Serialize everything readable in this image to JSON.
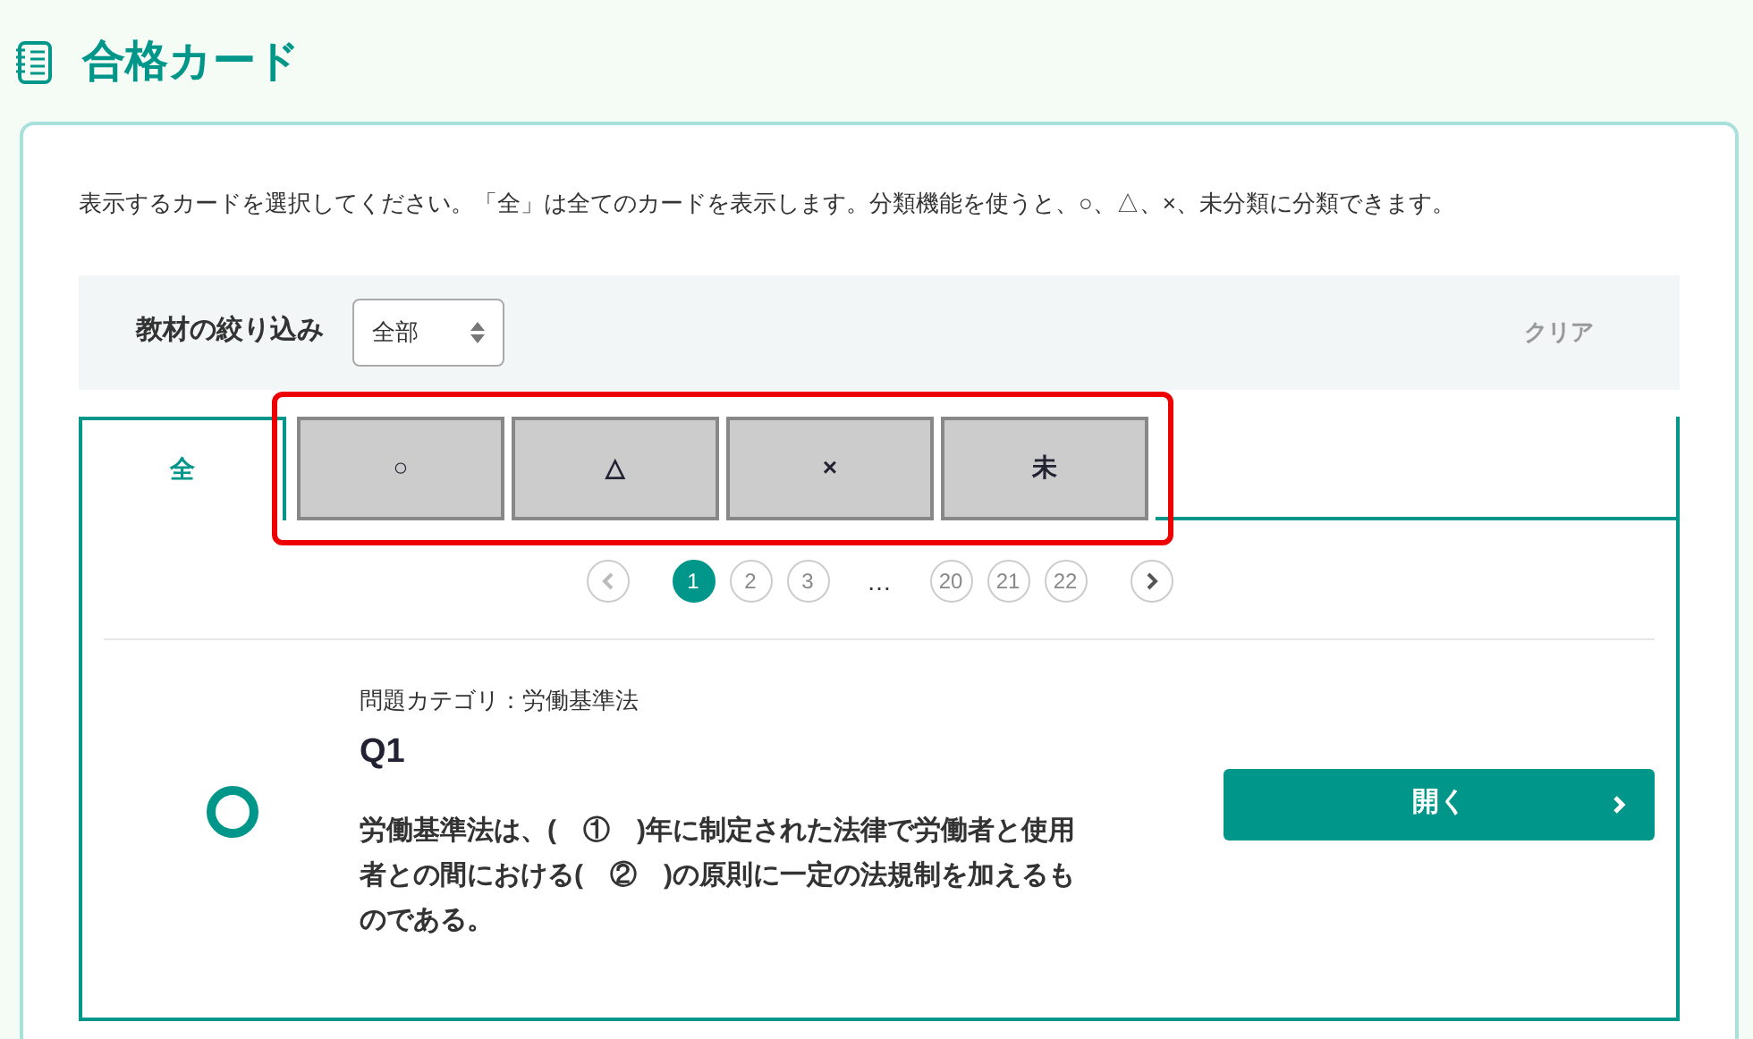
{
  "page_title": "合格カード",
  "instruction": "表示するカードを選択してください。「全」は全てのカードを表示します。分類機能を使うと、○、△、×、未分類に分類できます。",
  "filter": {
    "label": "教材の絞り込み",
    "value": "全部",
    "clear": "クリア"
  },
  "tabs": [
    {
      "label": "全",
      "selected": true,
      "highlighted": false
    },
    {
      "label": "○",
      "selected": false,
      "highlighted": true
    },
    {
      "label": "△",
      "selected": false,
      "highlighted": true
    },
    {
      "label": "×",
      "selected": false,
      "highlighted": true
    },
    {
      "label": "未",
      "selected": false,
      "highlighted": true
    }
  ],
  "pagination": [
    {
      "kind": "prev"
    },
    {
      "kind": "page",
      "label": "1",
      "selected": true
    },
    {
      "kind": "page",
      "label": "2",
      "selected": false
    },
    {
      "kind": "page",
      "label": "3",
      "selected": false
    },
    {
      "kind": "ellipsis",
      "label": "…"
    },
    {
      "kind": "page",
      "label": "20",
      "selected": false
    },
    {
      "kind": "page",
      "label": "21",
      "selected": false
    },
    {
      "kind": "page",
      "label": "22",
      "selected": false
    },
    {
      "kind": "next"
    }
  ],
  "cards": [
    {
      "category": "問題カテゴリ：労働基準法",
      "title": "Q1",
      "kind": "circle",
      "text": "労働基準法は、(　①　)年に制定された法律で労働者と使用者との間における(　②　)の原則に一定の法規制を加えるものである。",
      "button": "開く"
    }
  ]
}
